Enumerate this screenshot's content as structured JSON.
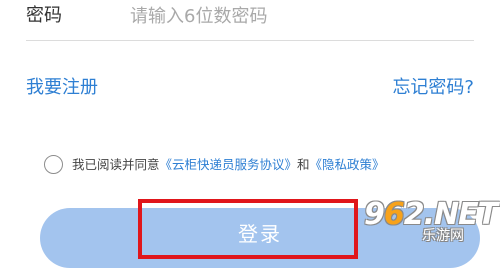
{
  "password": {
    "label": "密码",
    "placeholder": "请输入6位数密码",
    "value": ""
  },
  "links": {
    "register": "我要注册",
    "forgot_password": "忘记密码?"
  },
  "agreement": {
    "checked": false,
    "prefix": "我已阅读并同意",
    "service_agreement": "《云柜快递员服务协议》",
    "conjunction": "和",
    "privacy_policy": "《隐私政策》"
  },
  "login_button": {
    "label": "登录"
  },
  "watermark": {
    "logo_prefix": "9",
    "logo_accent": "6",
    "logo_rest": "2",
    "logo_suffix": ".NET",
    "subtitle": "乐游网"
  },
  "colors": {
    "link": "#2e7fd3",
    "button": "#a3c4ee",
    "highlight": "#e0161b"
  }
}
